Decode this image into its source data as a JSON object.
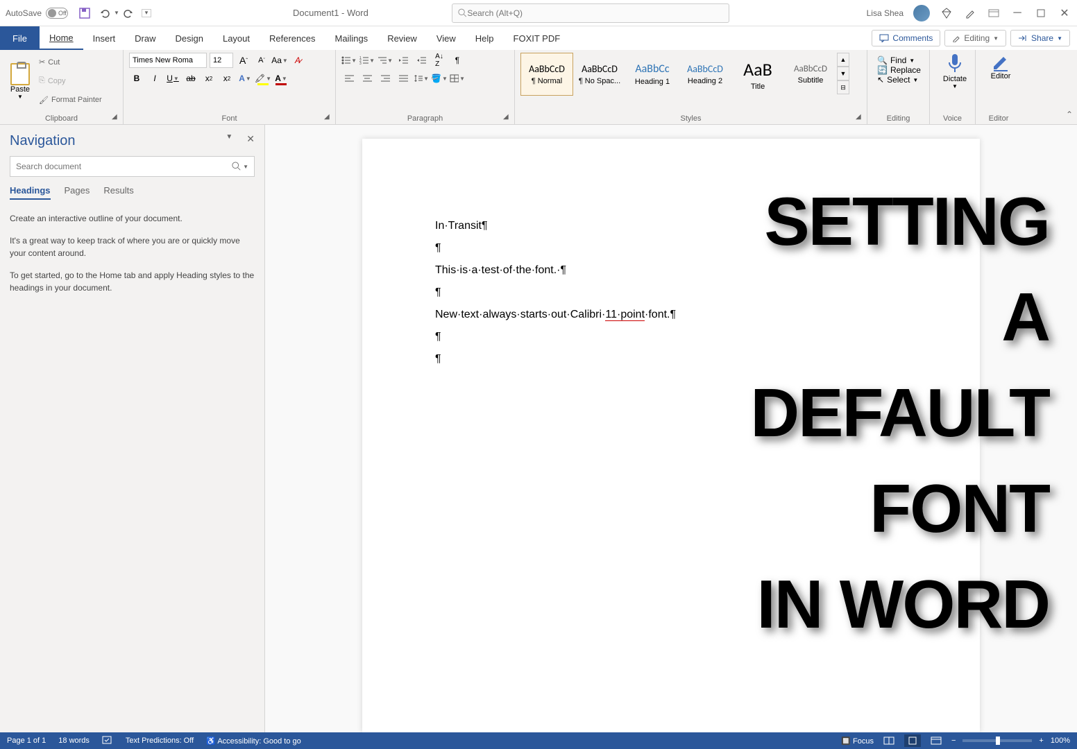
{
  "titlebar": {
    "autosave_label": "AutoSave",
    "autosave_state": "Off",
    "doc_title": "Document1  -  Word",
    "search_placeholder": "Search (Alt+Q)",
    "username": "Lisa Shea"
  },
  "tabs": {
    "file": "File",
    "items": [
      "Home",
      "Insert",
      "Draw",
      "Design",
      "Layout",
      "References",
      "Mailings",
      "Review",
      "View",
      "Help",
      "FOXIT PDF"
    ],
    "active_index": 0,
    "comments": "Comments",
    "editing": "Editing",
    "share": "Share"
  },
  "ribbon": {
    "clipboard": {
      "paste": "Paste",
      "cut": "Cut",
      "copy": "Copy",
      "format_painter": "Format Painter",
      "label": "Clipboard"
    },
    "font": {
      "name": "Times New Roma",
      "size": "12",
      "label": "Font"
    },
    "paragraph": {
      "label": "Paragraph"
    },
    "styles": {
      "items": [
        {
          "preview": "AaBbCcD",
          "name": "¶ Normal",
          "size": "14px",
          "selected": true
        },
        {
          "preview": "AaBbCcD",
          "name": "¶ No Spac...",
          "size": "14px"
        },
        {
          "preview": "AaBbCc",
          "name": "Heading 1",
          "size": "16px",
          "color": "#2e74b5"
        },
        {
          "preview": "AaBbCcD",
          "name": "Heading 2",
          "size": "14px",
          "color": "#2e74b5"
        },
        {
          "preview": "AaB",
          "name": "Title",
          "size": "26px"
        },
        {
          "preview": "AaBbCcD",
          "name": "Subtitle",
          "size": "13px",
          "color": "#666"
        }
      ],
      "label": "Styles"
    },
    "editing": {
      "find": "Find",
      "replace": "Replace",
      "select": "Select",
      "label": "Editing"
    },
    "voice": {
      "dictate": "Dictate",
      "label": "Voice"
    },
    "editor": {
      "editor": "Editor",
      "label": "Editor"
    }
  },
  "nav": {
    "title": "Navigation",
    "search_placeholder": "Search document",
    "tabs": [
      "Headings",
      "Pages",
      "Results"
    ],
    "active_tab": 0,
    "para1": "Create an interactive outline of your document.",
    "para2": "It's a great way to keep track of where you are or quickly move your content around.",
    "para3": "To get started, go to the Home tab and apply Heading styles to the headings in your document."
  },
  "document": {
    "line1": "In·Transit",
    "line2": "This·is·a·test·of·the·font.·",
    "line3a": "New·text·always·starts·out·Calibri·",
    "line3b": "11·point",
    "line3c": "·font."
  },
  "overlay": [
    "SETTING",
    "A",
    "DEFAULT",
    "FONT",
    "IN WORD"
  ],
  "statusbar": {
    "page": "Page 1 of 1",
    "words": "18 words",
    "predictions": "Text Predictions: Off",
    "accessibility": "Accessibility: Good to go",
    "focus": "Focus",
    "zoom": "100%"
  }
}
